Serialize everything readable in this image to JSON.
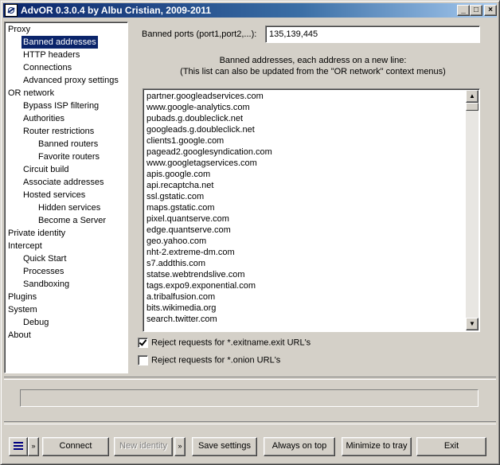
{
  "window": {
    "title": "AdvOR  0.3.0.4 by Albu Cristian, 2009-2011",
    "controls": {
      "minimize": "_",
      "maximize": "□",
      "close": "×"
    }
  },
  "tree": {
    "items": [
      {
        "label": "Proxy",
        "level": 0,
        "selected": false
      },
      {
        "label": "Banned addresses",
        "level": 1,
        "selected": true
      },
      {
        "label": "HTTP headers",
        "level": 1,
        "selected": false
      },
      {
        "label": "Connections",
        "level": 1,
        "selected": false
      },
      {
        "label": "Advanced proxy settings",
        "level": 1,
        "selected": false
      },
      {
        "label": "OR network",
        "level": 0,
        "selected": false
      },
      {
        "label": "Bypass ISP filtering",
        "level": 1,
        "selected": false
      },
      {
        "label": "Authorities",
        "level": 1,
        "selected": false
      },
      {
        "label": "Router restrictions",
        "level": 1,
        "selected": false
      },
      {
        "label": "Banned routers",
        "level": 2,
        "selected": false
      },
      {
        "label": "Favorite routers",
        "level": 2,
        "selected": false
      },
      {
        "label": "Circuit build",
        "level": 1,
        "selected": false
      },
      {
        "label": "Associate addresses",
        "level": 1,
        "selected": false
      },
      {
        "label": "Hosted services",
        "level": 1,
        "selected": false
      },
      {
        "label": "Hidden services",
        "level": 2,
        "selected": false
      },
      {
        "label": "Become a Server",
        "level": 2,
        "selected": false
      },
      {
        "label": "Private identity",
        "level": 0,
        "selected": false
      },
      {
        "label": "Intercept",
        "level": 0,
        "selected": false
      },
      {
        "label": "Quick Start",
        "level": 1,
        "selected": false
      },
      {
        "label": "Processes",
        "level": 1,
        "selected": false
      },
      {
        "label": "Sandboxing",
        "level": 1,
        "selected": false
      },
      {
        "label": "Plugins",
        "level": 0,
        "selected": false
      },
      {
        "label": "System",
        "level": 0,
        "selected": false
      },
      {
        "label": "Debug",
        "level": 1,
        "selected": false
      },
      {
        "label": "About",
        "level": 0,
        "selected": false
      }
    ]
  },
  "banned_ports": {
    "label": "Banned ports (port1,port2,...):",
    "value": "135,139,445"
  },
  "info": {
    "line1": "Banned addresses, each address on a new line:",
    "line2": "(This list can also be updated from the \"OR network\" context menus)"
  },
  "addresses": [
    "partner.googleadservices.com",
    "www.google-analytics.com",
    "pubads.g.doubleclick.net",
    "googleads.g.doubleclick.net",
    "clients1.google.com",
    "pagead2.googlesyndication.com",
    "www.googletagservices.com",
    "apis.google.com",
    "api.recaptcha.net",
    "ssl.gstatic.com",
    "maps.gstatic.com",
    "pixel.quantserve.com",
    "edge.quantserve.com",
    "geo.yahoo.com",
    "nht-2.extreme-dm.com",
    "s7.addthis.com",
    "statse.webtrendslive.com",
    "tags.expo9.exponential.com",
    "a.tribalfusion.com",
    "bits.wikimedia.org",
    "search.twitter.com"
  ],
  "scrollbar": {
    "up": "▲",
    "down": "▼"
  },
  "options": {
    "reject_exit": {
      "label": "Reject requests for *.exitname.exit URL's",
      "checked": true
    },
    "reject_onion": {
      "label": "Reject requests for *.onion URL's",
      "checked": false
    }
  },
  "status_text": "",
  "buttons": {
    "more": "»",
    "connect": "Connect",
    "new_identity": "New identity",
    "new_identity_more": "»",
    "save_settings": "Save settings",
    "always_on_top": "Always on top",
    "minimize_to_tray": "Minimize to tray",
    "exit": "Exit"
  }
}
